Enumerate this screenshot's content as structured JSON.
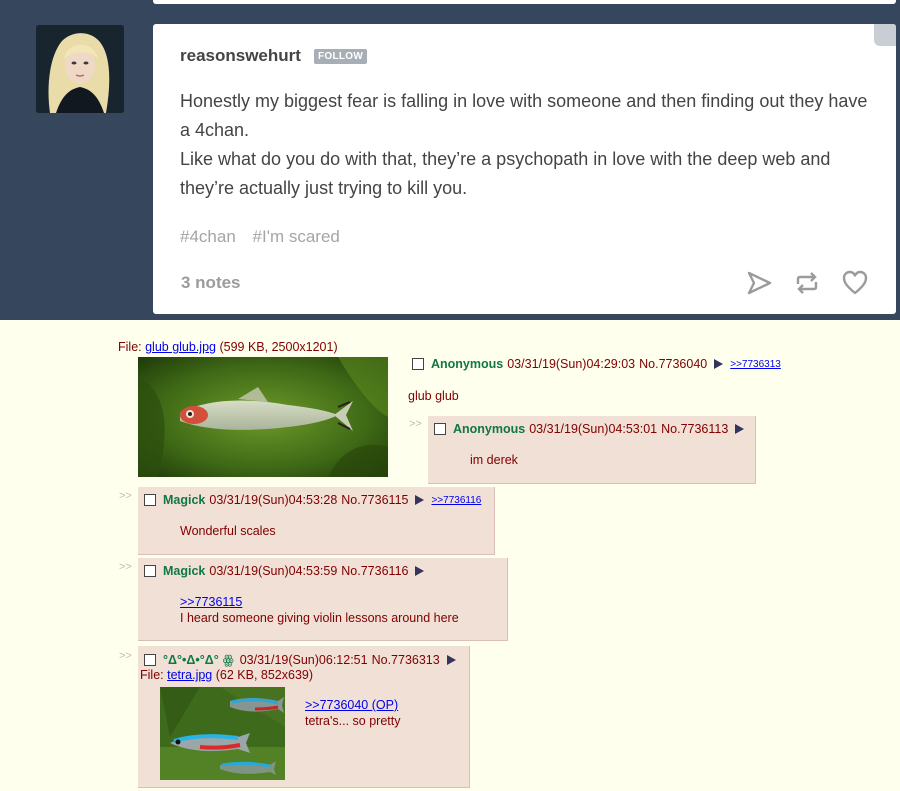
{
  "tumblr": {
    "username": "reasonswehurt",
    "follow_label": "FOLLOW",
    "body": [
      "Honestly my biggest fear is falling in love with someone and then finding out they have a 4chan.",
      "Like what do you do with that, they’re a psychopath in love with the deep web and they’re actually just trying to kill you."
    ],
    "tags": [
      "#4chan",
      "#I'm scared"
    ],
    "notes": "3 notes",
    "actions": [
      "send-icon",
      "reblog-icon",
      "like-icon"
    ]
  },
  "chan": {
    "op": {
      "file_label": "File: ",
      "file_name": "glub glub.jpg",
      "file_meta": " (599 KB, 2500x1201)",
      "name": "Anonymous",
      "datetime": "03/31/19(Sun)04:29:03",
      "no": "No.7736040",
      "backlink": ">>7736313",
      "message": "glub glub"
    },
    "replies": [
      {
        "arrows": ">>",
        "name": "Anonymous",
        "datetime": "03/31/19(Sun)04:53:01",
        "no": "No.7736113",
        "message": "im derek"
      },
      {
        "arrows": ">>",
        "name": "Magick",
        "datetime": "03/31/19(Sun)04:53:28",
        "no": "No.7736115",
        "backlink": ">>7736116",
        "message": "Wonderful scales"
      },
      {
        "arrows": ">>",
        "name": "Magick",
        "datetime": "03/31/19(Sun)04:53:59",
        "no": "No.7736116",
        "quote": ">>7736115",
        "message": "I heard someone giving violin lessons around here"
      },
      {
        "arrows": ">>",
        "name": "°Δ°•Δ•°Δ°",
        "flag": "ꙮ",
        "datetime": "03/31/19(Sun)06:12:51",
        "no": "No.7736313",
        "file_label": "File: ",
        "file_name": "tetra.jpg",
        "file_meta": " (62 KB, 852x639)",
        "quote": ">>7736040 (OP)",
        "message": "tetra's... so pretty"
      }
    ]
  },
  "colors": {
    "tumblr_bg": "#36465d",
    "chan_bg": "#ffffee",
    "reply_bg": "#f0e0d6",
    "name_green": "#117743",
    "maroon": "#800000",
    "link_blue": "#0000ee"
  }
}
